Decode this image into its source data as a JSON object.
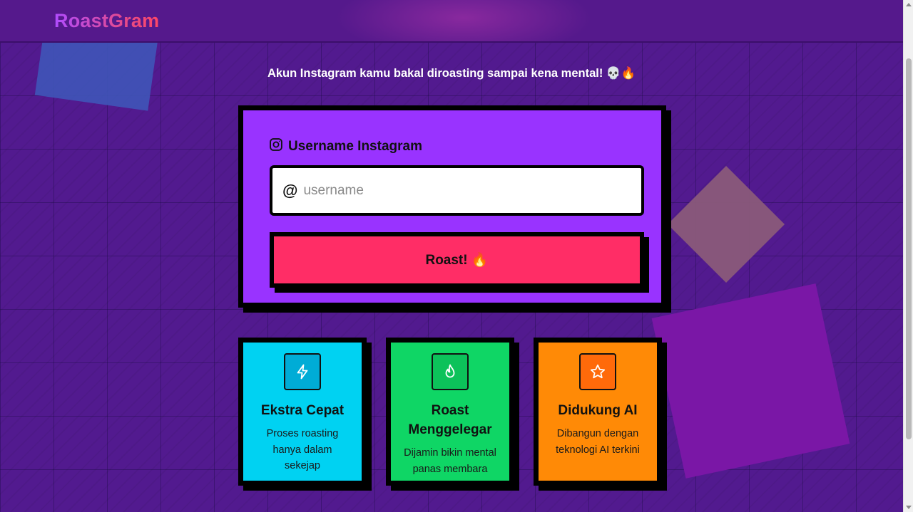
{
  "app": {
    "logo": "RoastGram"
  },
  "tagline": "Akun Instagram kamu bakal diroasting sampai kena mental! 💀🔥",
  "form": {
    "label": "Username Instagram",
    "at_symbol": "@",
    "placeholder": "username",
    "value": "",
    "submit_label": "Roast! 🔥"
  },
  "features": [
    {
      "title": "Ekstra Cepat",
      "desc": "Proses roasting hanya dalam sekejap",
      "icon": "lightning-icon",
      "color": "#00d2f2",
      "icon_bg": "#00acd6"
    },
    {
      "title": "Roast Menggelegar",
      "desc": "Dijamin bikin mental panas membara",
      "icon": "flame-icon",
      "color": "#0fd665",
      "icon_bg": "#0cc25a"
    },
    {
      "title": "Didukung AI",
      "desc": "Dibangun dengan teknologi AI terkini",
      "icon": "star-icon",
      "color": "#ff8a06",
      "icon_bg": "#ff6a0a"
    }
  ],
  "colors": {
    "background": "#521a8f",
    "form_card": "#9933ff",
    "button": "#ff2d66"
  }
}
